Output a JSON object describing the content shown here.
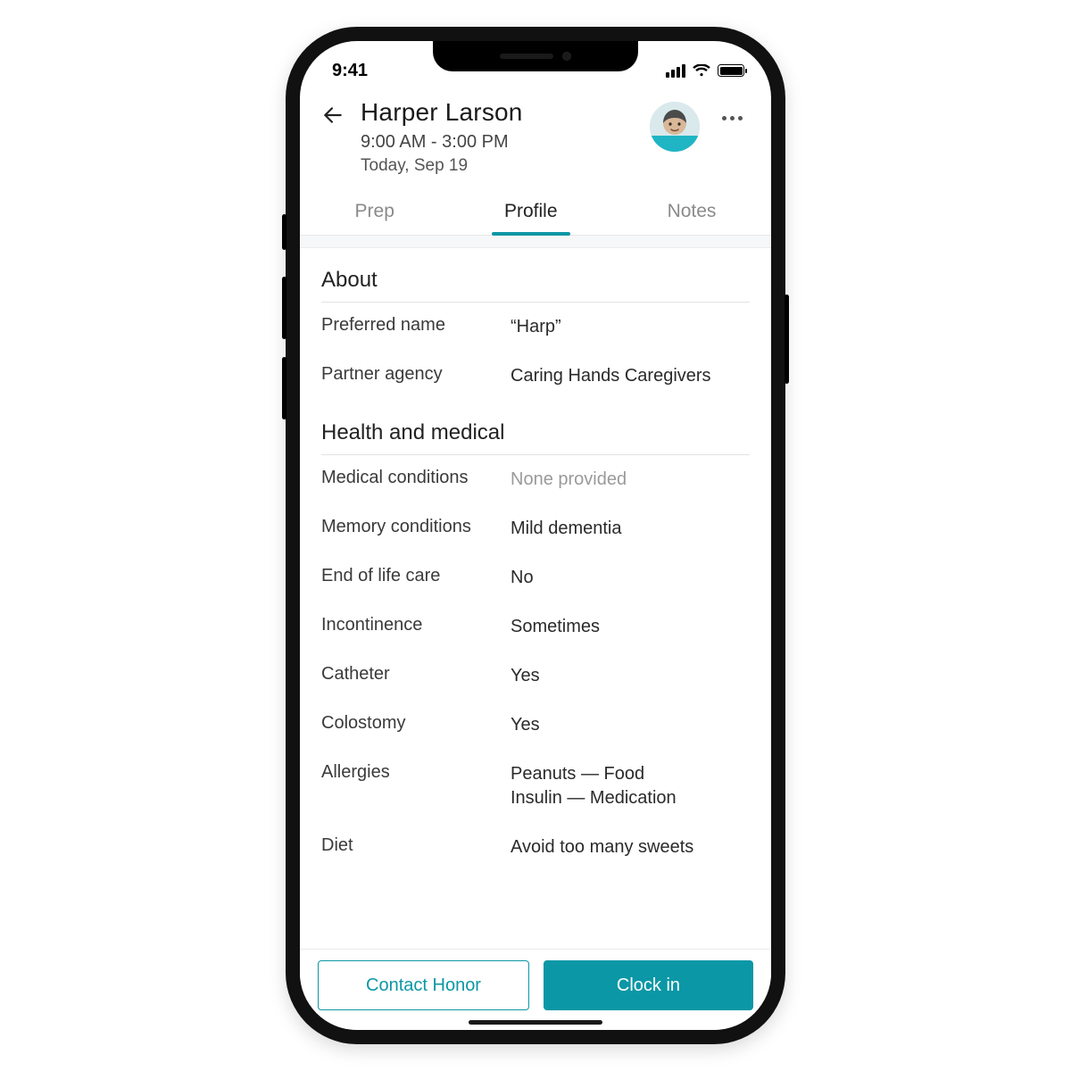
{
  "statusbar": {
    "time": "9:41"
  },
  "header": {
    "name": "Harper Larson",
    "time_range": "9:00 AM - 3:00 PM",
    "date": "Today, Sep 19"
  },
  "tabs": {
    "prep": {
      "label": "Prep"
    },
    "profile": {
      "label": "Profile"
    },
    "notes": {
      "label": "Notes"
    }
  },
  "sections": {
    "about": {
      "title": "About",
      "preferred_name": {
        "label": "Preferred name",
        "value": "“Harp”"
      },
      "partner_agency": {
        "label": "Partner agency",
        "value": "Caring Hands Caregivers"
      }
    },
    "health": {
      "title": "Health and medical",
      "medical_conditions": {
        "label": "Medical conditions",
        "value": "None provided"
      },
      "memory_conditions": {
        "label": "Memory conditions",
        "value": "Mild dementia"
      },
      "end_of_life_care": {
        "label": "End of life care",
        "value": "No"
      },
      "incontinence": {
        "label": "Incontinence",
        "value": "Sometimes"
      },
      "catheter": {
        "label": "Catheter",
        "value": "Yes"
      },
      "colostomy": {
        "label": "Colostomy",
        "value": "Yes"
      },
      "allergies": {
        "label": "Allergies",
        "value": "Peanuts — Food\nInsulin — Medication"
      },
      "diet": {
        "label": "Diet",
        "value": "Avoid too many sweets"
      }
    }
  },
  "buttons": {
    "contact": "Contact Honor",
    "clockin": "Clock in"
  },
  "colors": {
    "accent": "#0c97a6"
  }
}
